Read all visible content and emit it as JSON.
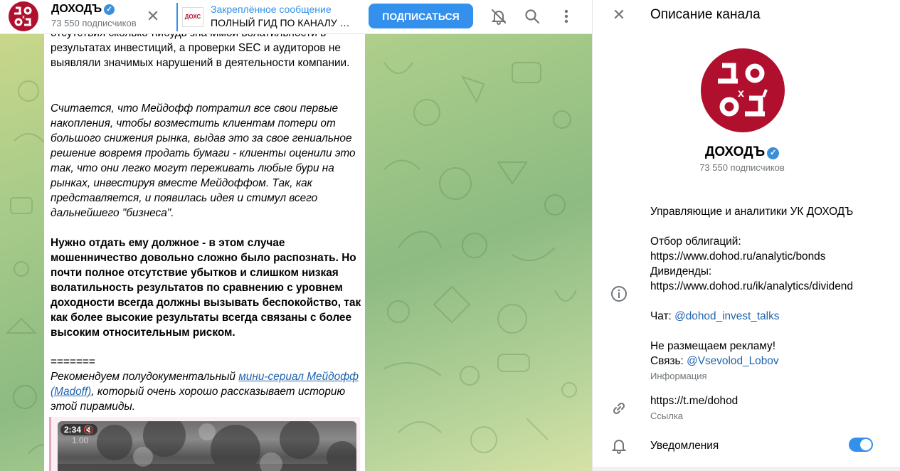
{
  "header": {
    "channel_title": "ДОХОДЪ",
    "subscribers": "73 550 подписчиков",
    "pinned_label": "Закреплённое сообщение",
    "pinned_text": "ПОЛНЫЙ ГИД ПО КАНАЛУ ДОХОДЪ",
    "pinned_thumb_text": "ДОХС",
    "subscribe_label": "ПОДПИСАТЬСЯ",
    "icons": [
      "close-icon",
      "bell-off-icon",
      "search-icon",
      "more-vertical-icon"
    ]
  },
  "message": {
    "p0": "отсутствия сколько-нибудь значимой волатильности в результатах инвестиций, а проверки SEC и аудиторов не выявляли значимых нарушений в деятельности компании.",
    "p1": "Считается, что Мейдофф потратил все свои первые накопления, чтобы возместить клиентам потери от большого снижения рынка, выдав это за свое гениальное решение вовремя продать бумаги - клиенты оценили это так, что они легко могут переживать любые бури на рынках, инвестируя вместе Мейдоффом. Так, как представляется, и появилась идея и стимул всего дальнейшего \"бизнеса\".",
    "p2": "Нужно отдать ему должное - в этом случае мошенничество довольно сложно было распознать. Но почти полное отсутствие убытков и слишком низкая волатильность результатов по сравнению с уровнем доходности всегда должны вызывать беспокойство, так как более высокие результаты всегда связаны с более высоким относительным риском.",
    "separator": "=======",
    "p3_before": "Рекомендуем полудокументальный ",
    "p3_link": "мини-сериал Мейдофф (Madoff)",
    "p3_after": ", который очень хорошо рассказывает историю этой пирамиды.",
    "video_time": "2:34",
    "video_speed": "1.00"
  },
  "panel": {
    "title": "Описание канала",
    "channel_name": "ДОХОДЪ",
    "subscribers": "73 550 подписчиков",
    "description_line1": "Управляющие и аналитики УК ДОХОДЪ",
    "bonds_label": "Отбор облигаций:",
    "bonds_url": "https://www.dohod.ru/analytic/bonds",
    "dividends_label": "Дивиденды:",
    "dividends_url": "https://www.dohod.ru/ik/analytics/dividend",
    "chat_prefix": "Чат: ",
    "chat_mention": "@dohod_invest_talks",
    "no_ads": "Не размещаем рекламу!",
    "contact_prefix": "Связь: ",
    "contact_mention": "@Vsevolod_Lobov",
    "info_label": "Информация",
    "link_url": "https://t.me/dohod",
    "link_label": "Ссылка",
    "notifications_label": "Уведомления",
    "notifications_enabled": true
  },
  "logo": {
    "text_top": "до",
    "text_mid": "х",
    "text_bottom": "од'",
    "color": "#b10f2e"
  },
  "colors": {
    "accent": "#3390ec",
    "link": "#1f63ad",
    "secondary_text": "#707579",
    "brand": "#b10f2e"
  }
}
